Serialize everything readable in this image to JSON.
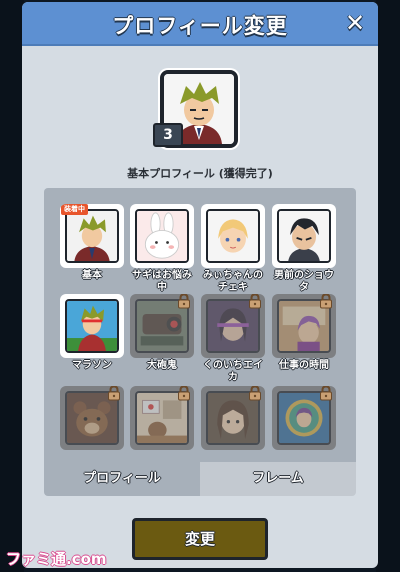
{
  "header": {
    "title": "プロフィール変更",
    "close_label": "✕"
  },
  "current_profile": {
    "level": "3",
    "avatar_icon": "businessman-avatar"
  },
  "section_title": "基本プロフィール (獲得完了)",
  "profiles": [
    {
      "name": "基本",
      "locked": false,
      "equipped": true,
      "equip_label": "装着中",
      "icon": "businessman-icon"
    },
    {
      "name": "サギはお悩み中",
      "locked": false,
      "equipped": false,
      "icon": "rabbit-icon"
    },
    {
      "name": "みぃちゃんのチェキ",
      "locked": false,
      "equipped": false,
      "icon": "blonde-girl-icon"
    },
    {
      "name": "男前のショウタ",
      "locked": false,
      "equipped": false,
      "icon": "dark-hair-boy-icon"
    },
    {
      "name": "マラソン",
      "locked": false,
      "equipped": false,
      "icon": "runner-icon"
    },
    {
      "name": "大砲鬼",
      "locked": true,
      "equipped": false,
      "icon": "cannon-oni-icon"
    },
    {
      "name": "くのいちエイカ",
      "locked": true,
      "equipped": false,
      "icon": "kunoichi-icon"
    },
    {
      "name": "仕事の時間",
      "locked": true,
      "equipped": false,
      "icon": "work-time-icon"
    },
    {
      "name": "",
      "locked": true,
      "equipped": false,
      "icon": "bear-icon"
    },
    {
      "name": "",
      "locked": true,
      "equipped": false,
      "icon": "room-icon"
    },
    {
      "name": "",
      "locked": true,
      "equipped": false,
      "icon": "brown-hair-girl-icon"
    },
    {
      "name": "",
      "locked": true,
      "equipped": false,
      "icon": "round-frame-icon"
    }
  ],
  "tabs": [
    {
      "label": "プロフィール"
    },
    {
      "label": "フレーム"
    }
  ],
  "change_button": "変更",
  "watermark": "ファミ通.com",
  "colors": {
    "header": "#5d90d2",
    "panel": "#d5dce3",
    "change_button": "#6b5a11",
    "equip_tag": "#e8552c"
  }
}
